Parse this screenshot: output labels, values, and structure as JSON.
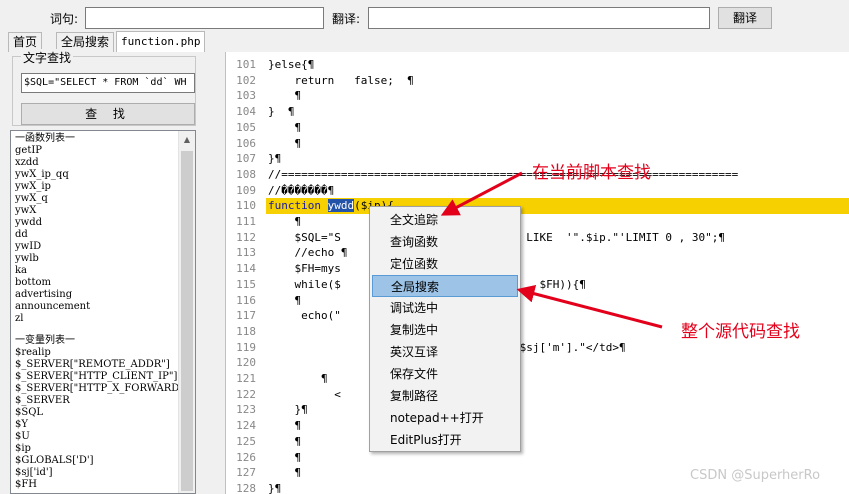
{
  "toolbar": {
    "word_label": "词句:",
    "translate_label": "翻译:",
    "translate_button": "翻译"
  },
  "tabs": [
    {
      "label": "首页"
    },
    {
      "label": "全局搜索"
    },
    {
      "label": "function.php"
    }
  ],
  "text_search": {
    "group_title": "文字查找",
    "input_value": "$SQL=\"SELECT * FROM `dd` WH",
    "button_label": "查 找"
  },
  "symbol_list": {
    "functions_header": "一函数列表一",
    "functions": [
      "getIP",
      "xzdd",
      "ywX_ip_qq",
      "ywX_ip",
      "ywX_q",
      "ywX",
      "ywdd",
      "dd",
      "ywID",
      "ywlb",
      "ka",
      "bottom",
      "advertising",
      "announcement",
      "zl"
    ],
    "variables_header": "一变量列表一",
    "variables": [
      "$realip",
      "$_SERVER[\"REMOTE_ADDR\"]",
      "$_SERVER[\"HTTP_CLIENT_IP\"]",
      "$_SERVER[\"HTTP_X_FORWARDED_",
      "$_SERVER",
      "$SQL",
      "$Y",
      "$U",
      "$ip",
      "$GLOBALS['D']",
      "$sj['id']",
      "$FH"
    ]
  },
  "editor": {
    "line_numbers": [
      "101",
      "102",
      "103",
      "104",
      "105",
      "106",
      "107",
      "108",
      "109",
      "110",
      "111",
      "112",
      "113",
      "114",
      "115",
      "116",
      "117",
      "118",
      "119",
      "120",
      "121",
      "122",
      "123",
      "124",
      "125",
      "126",
      "127",
      "128"
    ],
    "lines": [
      "}else{¶",
      "    return   false;  ¶",
      "    ¶",
      "}  ¶",
      "    ¶",
      "    ¶",
      "}¶",
      "//=====================================================================",
      "//�������¶",
      "",
      "    ¶",
      "    $SQL=\"S                  ERE  `ip` LIKE  '\".$ip.\"'LIMIT 0 , 30\";¶",
      "    //echo ¶",
      "    $FH=mys",
      "    while($                              $FH)){¶",
      "    ¶",
      "     echo(\"",
      "                                >¶",
      "                                s\\\">\".$sj['m'].\"</td>¶",
      "                                d>¶",
      "        ¶",
      "          <",
      "    }¶",
      "    ¶",
      "    ¶",
      "    ¶",
      "    ¶",
      "}¶"
    ],
    "function_keyword": "function",
    "selected_word": "ywdd",
    "function_rest": "($ip){"
  },
  "context_menu": {
    "items": [
      "全文追踪",
      "查询函数",
      "定位函数",
      "全局搜索",
      "调试选中",
      "复制选中",
      "英汉互译",
      "保存文件",
      "复制路径",
      "notepad++打开",
      "EditPlus打开"
    ],
    "highlighted_index": 3
  },
  "annotations": {
    "top_note": "在当前脚本查找",
    "bottom_note": "整个源代码查找",
    "color": "#e3001b"
  },
  "watermark": "CSDN @SuperherRo"
}
